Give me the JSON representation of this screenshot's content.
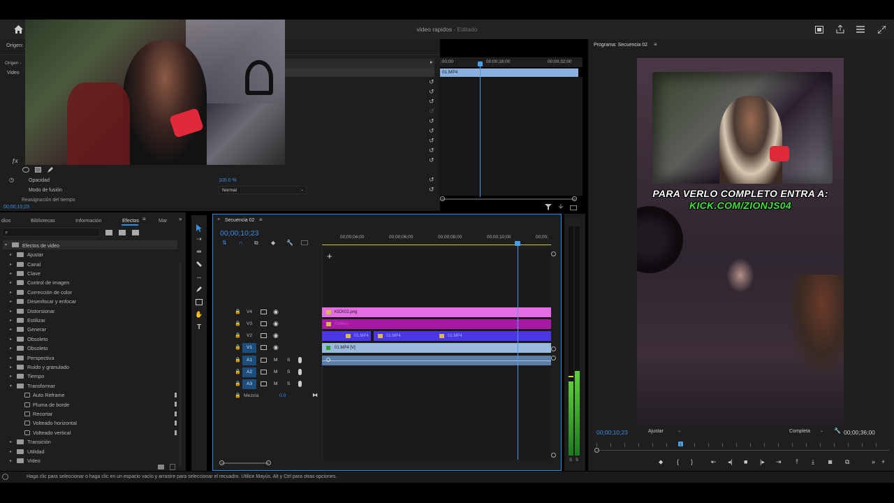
{
  "app": {
    "title": "video rapidos",
    "title_status": "- Editado"
  },
  "source_panel": {
    "tab_origen": "Origen:",
    "origen_row": "Origen -",
    "video_label": "Video"
  },
  "effect_controls": {
    "opacity_label": "Opacidad",
    "opacity_value": "100.0 %",
    "blend_label": "Modo de fusión",
    "blend_value": "Normal",
    "time_remap_label": "Reasignación del tiempo",
    "timecode": "00;00;10;23"
  },
  "ec_timeline": {
    "ticks": [
      ";00;00",
      "00;00;16;00",
      "00;00;32;00"
    ],
    "clip_label": "01.MP4"
  },
  "effects_panel": {
    "tabs": [
      "dios",
      "Bibliotecas",
      "Información",
      "Efectos",
      "Mar"
    ],
    "root": "Efectos de video",
    "items": [
      "Ajustar",
      "Canal",
      "Clave",
      "Control de imagen",
      "Corrección de color",
      "Desenfocar y enfocar",
      "Distorsionar",
      "Estilizar",
      "Generar",
      "Obsoleto",
      "Obsoleto",
      "Perspectiva",
      "Ruido y granulado",
      "Tiempo",
      "Transformar"
    ],
    "transform_children": [
      "Auto Reframe",
      "Pluma de borde",
      "Recortar",
      "Volteado horizontal",
      "Volteado vertical"
    ],
    "tail": [
      "Transición",
      "Utilidad",
      "Video"
    ]
  },
  "timeline": {
    "tab_label": "Secuencia 02",
    "timecode": "00;00;10;23",
    "ruler": [
      "00;00;04;00",
      "00;00;06;00",
      "00;00;08;00",
      "00;00;10;00",
      "00;00;"
    ],
    "video_tracks": [
      "V4",
      "V3",
      "V2",
      "V1"
    ],
    "audio_tracks": [
      "A1",
      "A2",
      "A3"
    ],
    "mix_label": "Mezcla",
    "mix_value": "0.0",
    "m_label": "M",
    "s_label": "S",
    "clips": {
      "v4": "KICK02.png",
      "v3": "Gráfico",
      "v2a": "01.MP4",
      "v2b": "01.MP4",
      "v2c": "01.MP4",
      "v1": "01.MP4 [V]"
    },
    "colors": {
      "v4": "#e46de4",
      "v3": "#a61aa6",
      "v2": "#4b37e6",
      "v1": "#9bb8dd",
      "a1": "#5b7ea8"
    }
  },
  "meters": {
    "s1": "S",
    "s2": "S"
  },
  "program": {
    "tab_label": "Programa: Secuencia 02",
    "timecode": "00;00;10;23",
    "fit_value": "Ajustar",
    "quality_value": "Completa",
    "duration": "00;00;36;00",
    "overlay_line1": "PARA VERLO COMPLETO ENTRA A:",
    "overlay_line2": "KICK.COM/ZIONJS04"
  },
  "status_bar": {
    "text": "Haga clic para seleccionar o haga clic en un espacio vacío y arrastre para seleccionar el recuadro. Utilice Mayús, Alt y Ctrl para otras opciones."
  }
}
